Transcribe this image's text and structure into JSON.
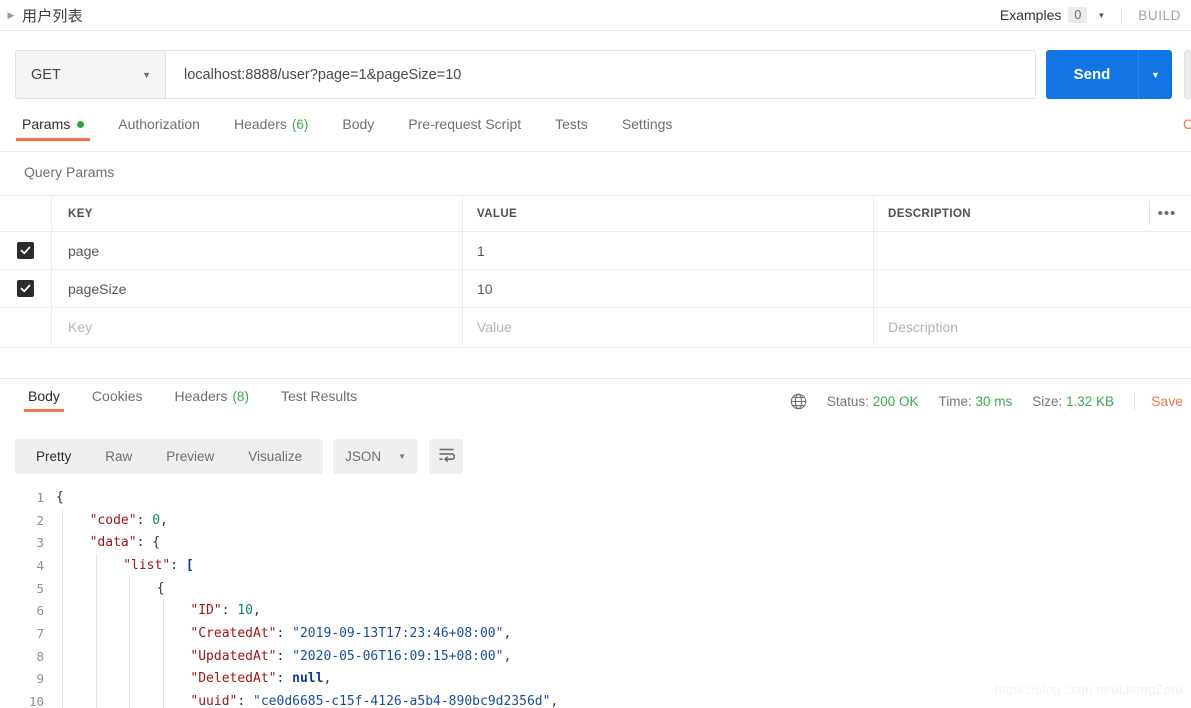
{
  "titlebar": {
    "request_name": "用户列表",
    "examples_label": "Examples",
    "examples_count": "0",
    "build_label": "BUILD"
  },
  "url_bar": {
    "method": "GET",
    "url": "localhost:8888/user?page=1&pageSize=10",
    "send_label": "Send"
  },
  "request_tabs": [
    {
      "label": "Params",
      "active": true,
      "marker": "dot"
    },
    {
      "label": "Authorization",
      "active": false
    },
    {
      "label": "Headers",
      "active": false,
      "count": "(6)"
    },
    {
      "label": "Body",
      "active": false
    },
    {
      "label": "Pre-request Script",
      "active": false
    },
    {
      "label": "Tests",
      "active": false
    },
    {
      "label": "Settings",
      "active": false
    }
  ],
  "cookies_tab": "Cookies",
  "query_params": {
    "section_title": "Query Params",
    "columns": [
      "KEY",
      "VALUE",
      "DESCRIPTION"
    ],
    "rows": [
      {
        "checked": true,
        "key": "page",
        "value": "1",
        "description": ""
      },
      {
        "checked": true,
        "key": "pageSize",
        "value": "10",
        "description": ""
      }
    ],
    "placeholder_row": {
      "key": "Key",
      "value": "Value",
      "description": "Description"
    },
    "more_label": "•••"
  },
  "response_tabs": [
    {
      "label": "Body",
      "active": true
    },
    {
      "label": "Cookies",
      "active": false
    },
    {
      "label": "Headers",
      "active": false,
      "count": "(8)"
    },
    {
      "label": "Test Results",
      "active": false
    }
  ],
  "response_meta": {
    "status_label": "Status:",
    "status_value": "200 OK",
    "time_label": "Time:",
    "time_value": "30 ms",
    "size_label": "Size:",
    "size_value": "1.32 KB",
    "save_label": "Save"
  },
  "body_toolbar": {
    "views": [
      {
        "label": "Pretty",
        "active": true
      },
      {
        "label": "Raw",
        "active": false
      },
      {
        "label": "Preview",
        "active": false
      },
      {
        "label": "Visualize",
        "active": false
      }
    ],
    "language": "JSON",
    "wrap_icon": "word-wrap-icon"
  },
  "colors": {
    "accent_orange": "#f2734a",
    "send_blue": "#1175e4",
    "success_green": "#3aab4a",
    "checkbox_dark": "#2c2c2c"
  },
  "response_body": {
    "lines": [
      {
        "n": 1,
        "indent": 0,
        "guides": 0,
        "parts": [
          {
            "t": "{",
            "c": "tok-brace"
          }
        ]
      },
      {
        "n": 2,
        "indent": 1,
        "guides": 1,
        "parts": [
          {
            "t": "\"code\"",
            "c": "tok-key"
          },
          {
            "t": ": ",
            "c": "tok-punc"
          },
          {
            "t": "0",
            "c": "tok-num"
          },
          {
            "t": ",",
            "c": "tok-punc"
          }
        ]
      },
      {
        "n": 3,
        "indent": 1,
        "guides": 1,
        "parts": [
          {
            "t": "\"data\"",
            "c": "tok-key"
          },
          {
            "t": ": ",
            "c": "tok-punc"
          },
          {
            "t": "{",
            "c": "tok-brace"
          }
        ]
      },
      {
        "n": 4,
        "indent": 2,
        "guides": 2,
        "parts": [
          {
            "t": "\"list\"",
            "c": "tok-key"
          },
          {
            "t": ": ",
            "c": "tok-punc"
          },
          {
            "t": "[",
            "c": "tok-bracket"
          }
        ]
      },
      {
        "n": 5,
        "indent": 3,
        "guides": 3,
        "parts": [
          {
            "t": "{",
            "c": "tok-brace"
          }
        ]
      },
      {
        "n": 6,
        "indent": 4,
        "guides": 4,
        "parts": [
          {
            "t": "\"ID\"",
            "c": "tok-key"
          },
          {
            "t": ": ",
            "c": "tok-punc"
          },
          {
            "t": "10",
            "c": "tok-num"
          },
          {
            "t": ",",
            "c": "tok-punc"
          }
        ]
      },
      {
        "n": 7,
        "indent": 4,
        "guides": 4,
        "parts": [
          {
            "t": "\"CreatedAt\"",
            "c": "tok-key"
          },
          {
            "t": ": ",
            "c": "tok-punc"
          },
          {
            "t": "\"2019-09-13T17:23:46+08:00\"",
            "c": "tok-str"
          },
          {
            "t": ",",
            "c": "tok-punc"
          }
        ]
      },
      {
        "n": 8,
        "indent": 4,
        "guides": 4,
        "parts": [
          {
            "t": "\"UpdatedAt\"",
            "c": "tok-key"
          },
          {
            "t": ": ",
            "c": "tok-punc"
          },
          {
            "t": "\"2020-05-06T16:09:15+08:00\"",
            "c": "tok-str"
          },
          {
            "t": ",",
            "c": "tok-punc"
          }
        ]
      },
      {
        "n": 9,
        "indent": 4,
        "guides": 4,
        "parts": [
          {
            "t": "\"DeletedAt\"",
            "c": "tok-key"
          },
          {
            "t": ": ",
            "c": "tok-punc"
          },
          {
            "t": "null",
            "c": "tok-null"
          },
          {
            "t": ",",
            "c": "tok-punc"
          }
        ]
      },
      {
        "n": 10,
        "indent": 4,
        "guides": 4,
        "parts": [
          {
            "t": "\"uuid\"",
            "c": "tok-key"
          },
          {
            "t": ": ",
            "c": "tok-punc"
          },
          {
            "t": "\"ce0d6685-c15f-4126-a5b4-890bc9d2356d\"",
            "c": "tok-str"
          },
          {
            "t": ",",
            "c": "tok-punc"
          }
        ]
      }
    ]
  },
  "watermark": "https://blog.csdn.net/LitongZero"
}
